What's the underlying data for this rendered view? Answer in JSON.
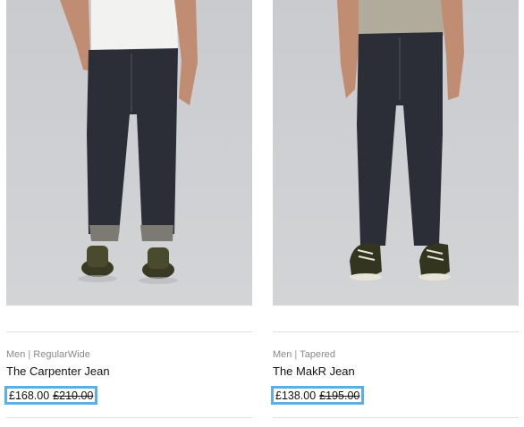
{
  "products": [
    {
      "category": "Men",
      "fit": "RegularWide",
      "name": "The Carpenter Jean",
      "price": "£168.00",
      "original_price": "£210.00"
    },
    {
      "category": "Men",
      "fit": "Tapered",
      "name": "The MakR Jean",
      "price": "£138.00",
      "original_price": "£195.00"
    }
  ],
  "colors": {
    "highlight": "#5aafe6",
    "photo_background": "#cfd1d4",
    "denim": "#2b2e36"
  }
}
